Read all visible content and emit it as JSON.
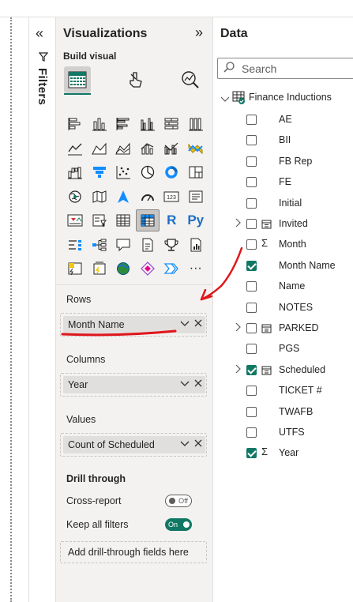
{
  "filters": {
    "label": "Filters",
    "collapse_icon": "double-chevron-left-icon",
    "filter_icon": "filter-icon"
  },
  "visualizations": {
    "title": "Visualizations",
    "expand_icon": "double-chevron-right-icon",
    "build_visual_label": "Build visual",
    "tool_icons": [
      "build-visual-icon",
      "format-visual-icon",
      "analytics-icon"
    ],
    "gallery_rows": [
      [
        "stacked-bar-chart-icon",
        "stacked-column-chart-icon",
        "clustered-bar-chart-icon",
        "clustered-column-chart-icon",
        "100-stacked-bar-chart-icon",
        "100-stacked-column-chart-icon"
      ],
      [
        "line-chart-icon",
        "area-chart-icon",
        "stacked-area-chart-icon",
        "line-and-stacked-column-chart-icon",
        "line-and-clustered-column-chart-icon",
        "ribbon-chart-icon"
      ],
      [
        "waterfall-chart-icon",
        "funnel-icon",
        "scatter-chart-icon",
        "pie-chart-icon",
        "donut-chart-icon",
        "treemap-icon"
      ],
      [
        "map-icon",
        "filled-map-icon",
        "azure-map-icon",
        "gauge-icon",
        "card-icon",
        "multi-row-card-icon"
      ],
      [
        "kpi-icon",
        "slicer-icon",
        "table-icon",
        "matrix-icon",
        "r-script-visual-icon",
        "python-visual-icon"
      ],
      [
        "key-influencers-icon",
        "decomposition-tree-icon",
        "qa-icon",
        "smart-narrative-icon",
        "trophy-metrics-icon",
        "paginated-report-icon"
      ],
      [
        "power-apps-icon",
        "power-automate-icon",
        "arcgis-map-icon",
        "diamond-visual-icon",
        "chevron-visual-icon",
        "more-visuals-icon"
      ]
    ],
    "gallery_text": {
      "card": "123",
      "r": "R",
      "py": "Py",
      "more": "···"
    },
    "wells": {
      "rows": {
        "label": "Rows",
        "field": "Month Name"
      },
      "columns": {
        "label": "Columns",
        "field": "Year"
      },
      "values": {
        "label": "Values",
        "field": "Count of Scheduled"
      }
    },
    "drill_through": {
      "title": "Drill through",
      "cross_report_label": "Cross-report",
      "cross_report_state": "Off",
      "keep_filters_label": "Keep all filters",
      "keep_filters_state": "On",
      "add_fields": "Add drill-through fields here"
    }
  },
  "data": {
    "title": "Data",
    "more_icon": "more-options-icon",
    "search_placeholder": "Search",
    "table_name": "Finance Inductions",
    "fields": [
      {
        "name": "AE",
        "checked": false,
        "type": "",
        "expandable": false
      },
      {
        "name": "BII",
        "checked": false,
        "type": "",
        "expandable": false
      },
      {
        "name": "FB Rep",
        "checked": false,
        "type": "",
        "expandable": false
      },
      {
        "name": "FE",
        "checked": false,
        "type": "",
        "expandable": false
      },
      {
        "name": "Initial",
        "checked": false,
        "type": "",
        "expandable": false
      },
      {
        "name": "Invited",
        "checked": false,
        "type": "date",
        "expandable": true
      },
      {
        "name": "Month",
        "checked": false,
        "type": "sum",
        "expandable": false
      },
      {
        "name": "Month Name",
        "checked": true,
        "type": "",
        "expandable": false
      },
      {
        "name": "Name",
        "checked": false,
        "type": "",
        "expandable": false
      },
      {
        "name": "NOTES",
        "checked": false,
        "type": "",
        "expandable": false
      },
      {
        "name": "PARKED",
        "checked": false,
        "type": "date",
        "expandable": true
      },
      {
        "name": "PGS",
        "checked": false,
        "type": "",
        "expandable": false
      },
      {
        "name": "Scheduled",
        "checked": true,
        "type": "date",
        "expandable": true
      },
      {
        "name": "TICKET #",
        "checked": false,
        "type": "",
        "expandable": false
      },
      {
        "name": "TWAFB",
        "checked": false,
        "type": "",
        "expandable": false
      },
      {
        "name": "UTFS",
        "checked": false,
        "type": "",
        "expandable": false
      },
      {
        "name": "Year",
        "checked": true,
        "type": "sum",
        "expandable": false
      }
    ]
  },
  "colors": {
    "accent": "#117865",
    "pane_bg": "#f3f2f1",
    "annotation": "#e0161b"
  }
}
